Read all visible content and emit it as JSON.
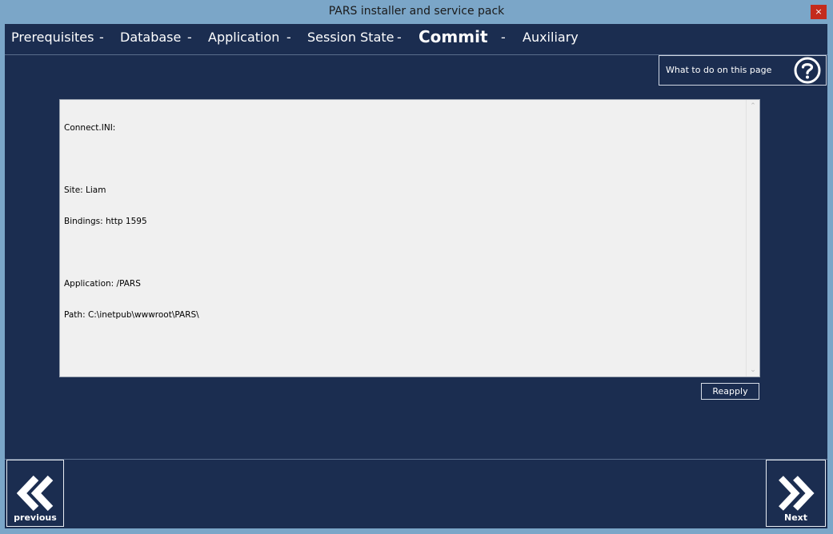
{
  "window": {
    "title": "PARS installer and service pack",
    "close_label": "×"
  },
  "steps": {
    "items": [
      "Prerequisites",
      "Database",
      "Application",
      "Session State",
      "Commit",
      "Auxiliary"
    ],
    "separator": "-",
    "active": "Commit"
  },
  "help": {
    "label": "What to do on this page",
    "icon": "question-circle-icon"
  },
  "summary": {
    "lines": [
      "Connect.INI:",
      "",
      "Site: Liam",
      "Bindings: http 1595",
      "",
      "Application: /PARS",
      "Path: C:\\inetpub\\wwwroot\\PARS\\"
    ]
  },
  "actions": {
    "reapply_label": "Reapply"
  },
  "nav": {
    "previous_label": "previous",
    "next_label": "Next"
  },
  "colors": {
    "background": "#1b2d50",
    "titlebar": "#7ba6c8",
    "close": "#c42b1c"
  }
}
